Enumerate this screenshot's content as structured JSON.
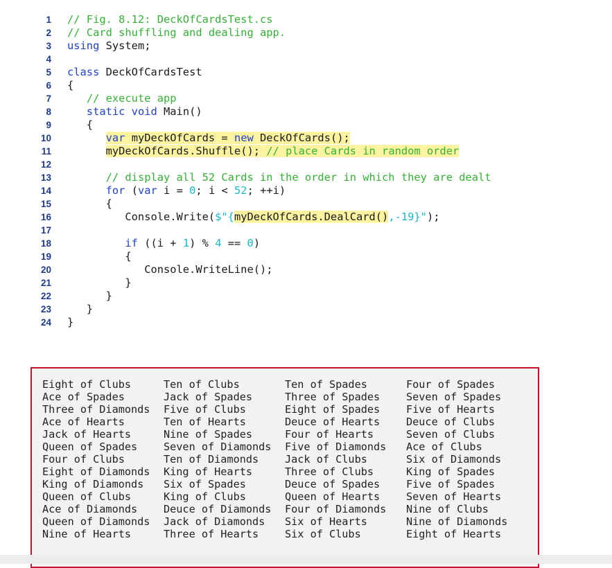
{
  "code_lines": [
    {
      "n": "1",
      "tokens": [
        {
          "t": "// Fig. 8.12: DeckOfCardsTest.cs",
          "c": "cm"
        }
      ]
    },
    {
      "n": "2",
      "tokens": [
        {
          "t": "// Card shuffling and dealing app.",
          "c": "cm"
        }
      ]
    },
    {
      "n": "3",
      "tokens": [
        {
          "t": "using",
          "c": "kw"
        },
        {
          "t": " System;",
          "c": ""
        }
      ]
    },
    {
      "n": "4",
      "tokens": []
    },
    {
      "n": "5",
      "tokens": [
        {
          "t": "class",
          "c": "kw"
        },
        {
          "t": " DeckOfCardsTest",
          "c": ""
        }
      ]
    },
    {
      "n": "6",
      "tokens": [
        {
          "t": "{",
          "c": ""
        }
      ]
    },
    {
      "n": "7",
      "tokens": [
        {
          "t": "   ",
          "c": ""
        },
        {
          "t": "// execute app",
          "c": "cm"
        }
      ]
    },
    {
      "n": "8",
      "tokens": [
        {
          "t": "   ",
          "c": ""
        },
        {
          "t": "static void",
          "c": "kw"
        },
        {
          "t": " Main()",
          "c": ""
        }
      ]
    },
    {
      "n": "9",
      "tokens": [
        {
          "t": "   {",
          "c": ""
        }
      ]
    },
    {
      "n": "10",
      "tokens": [
        {
          "t": "      ",
          "c": ""
        },
        {
          "t": "var",
          "c": "kw hl"
        },
        {
          "t": " myDeckOfCards = ",
          "c": "hl"
        },
        {
          "t": "new",
          "c": "kw hl"
        },
        {
          "t": " DeckOfCards();",
          "c": "hl"
        }
      ]
    },
    {
      "n": "11",
      "tokens": [
        {
          "t": "      ",
          "c": ""
        },
        {
          "t": "myDeckOfCards.Shuffle(); ",
          "c": "hl"
        },
        {
          "t": "// place Cards in random order",
          "c": "cm hl"
        }
      ]
    },
    {
      "n": "12",
      "tokens": []
    },
    {
      "n": "13",
      "tokens": [
        {
          "t": "      ",
          "c": ""
        },
        {
          "t": "// display all 52 Cards in the order in which they are dealt",
          "c": "cm"
        }
      ]
    },
    {
      "n": "14",
      "tokens": [
        {
          "t": "      ",
          "c": ""
        },
        {
          "t": "for",
          "c": "kw"
        },
        {
          "t": " (",
          "c": ""
        },
        {
          "t": "var",
          "c": "kw"
        },
        {
          "t": " i = ",
          "c": ""
        },
        {
          "t": "0",
          "c": "num"
        },
        {
          "t": "; i < ",
          "c": ""
        },
        {
          "t": "52",
          "c": "num"
        },
        {
          "t": "; ++i)",
          "c": ""
        }
      ]
    },
    {
      "n": "15",
      "tokens": [
        {
          "t": "      {",
          "c": ""
        }
      ]
    },
    {
      "n": "16",
      "tokens": [
        {
          "t": "         Console.Write(",
          "c": ""
        },
        {
          "t": "$\"{",
          "c": "str"
        },
        {
          "t": "myDeckOfCards.DealCard()",
          "c": "hl"
        },
        {
          "t": ",-19}\"",
          "c": "str"
        },
        {
          "t": ");",
          "c": ""
        }
      ]
    },
    {
      "n": "17",
      "tokens": []
    },
    {
      "n": "18",
      "tokens": [
        {
          "t": "         ",
          "c": ""
        },
        {
          "t": "if",
          "c": "kw"
        },
        {
          "t": " ((i + ",
          "c": ""
        },
        {
          "t": "1",
          "c": "num"
        },
        {
          "t": ") % ",
          "c": ""
        },
        {
          "t": "4",
          "c": "num"
        },
        {
          "t": " == ",
          "c": ""
        },
        {
          "t": "0",
          "c": "num"
        },
        {
          "t": ")",
          "c": ""
        }
      ]
    },
    {
      "n": "19",
      "tokens": [
        {
          "t": "         {",
          "c": ""
        }
      ]
    },
    {
      "n": "20",
      "tokens": [
        {
          "t": "            Console.WriteLine();",
          "c": ""
        }
      ]
    },
    {
      "n": "21",
      "tokens": [
        {
          "t": "         }",
          "c": ""
        }
      ]
    },
    {
      "n": "22",
      "tokens": [
        {
          "t": "      }",
          "c": ""
        }
      ]
    },
    {
      "n": "23",
      "tokens": [
        {
          "t": "   }",
          "c": ""
        }
      ]
    },
    {
      "n": "24",
      "tokens": [
        {
          "t": "}",
          "c": ""
        }
      ]
    }
  ],
  "output_rows": [
    [
      "Eight of Clubs",
      "Ten of Clubs",
      "Ten of Spades",
      "Four of Spades"
    ],
    [
      "Ace of Spades",
      "Jack of Spades",
      "Three of Spades",
      "Seven of Spades"
    ],
    [
      "Three of Diamonds",
      "Five of Clubs",
      "Eight of Spades",
      "Five of Hearts"
    ],
    [
      "Ace of Hearts",
      "Ten of Hearts",
      "Deuce of Hearts",
      "Deuce of Clubs"
    ],
    [
      "Jack of Hearts",
      "Nine of Spades",
      "Four of Hearts",
      "Seven of Clubs"
    ],
    [
      "Queen of Spades",
      "Seven of Diamonds",
      "Five of Diamonds",
      "Ace of Clubs"
    ],
    [
      "Four of Clubs",
      "Ten of Diamonds",
      "Jack of Clubs",
      "Six of Diamonds"
    ],
    [
      "Eight of Diamonds",
      "King of Hearts",
      "Three of Clubs",
      "King of Spades"
    ],
    [
      "King of Diamonds",
      "Six of Spades",
      "Deuce of Spades",
      "Five of Spades"
    ],
    [
      "Queen of Clubs",
      "King of Clubs",
      "Queen of Hearts",
      "Seven of Hearts"
    ],
    [
      "Ace of Diamonds",
      "Deuce of Diamonds",
      "Four of Diamonds",
      "Nine of Clubs"
    ],
    [
      "Queen of Diamonds",
      "Jack of Diamonds",
      "Six of Hearts",
      "Nine of Diamonds"
    ],
    [
      "Nine of Hearts",
      "Three of Hearts",
      "Six of Clubs",
      "Eight of Hearts"
    ]
  ],
  "colors": {
    "keyword": "#2040c8",
    "comment": "#35b035",
    "literal": "#1ab8c8",
    "highlight": "#fbf3a0",
    "line_number": "#1d3a8f",
    "output_border": "#c8102e",
    "output_background": "#f2f2f2"
  }
}
